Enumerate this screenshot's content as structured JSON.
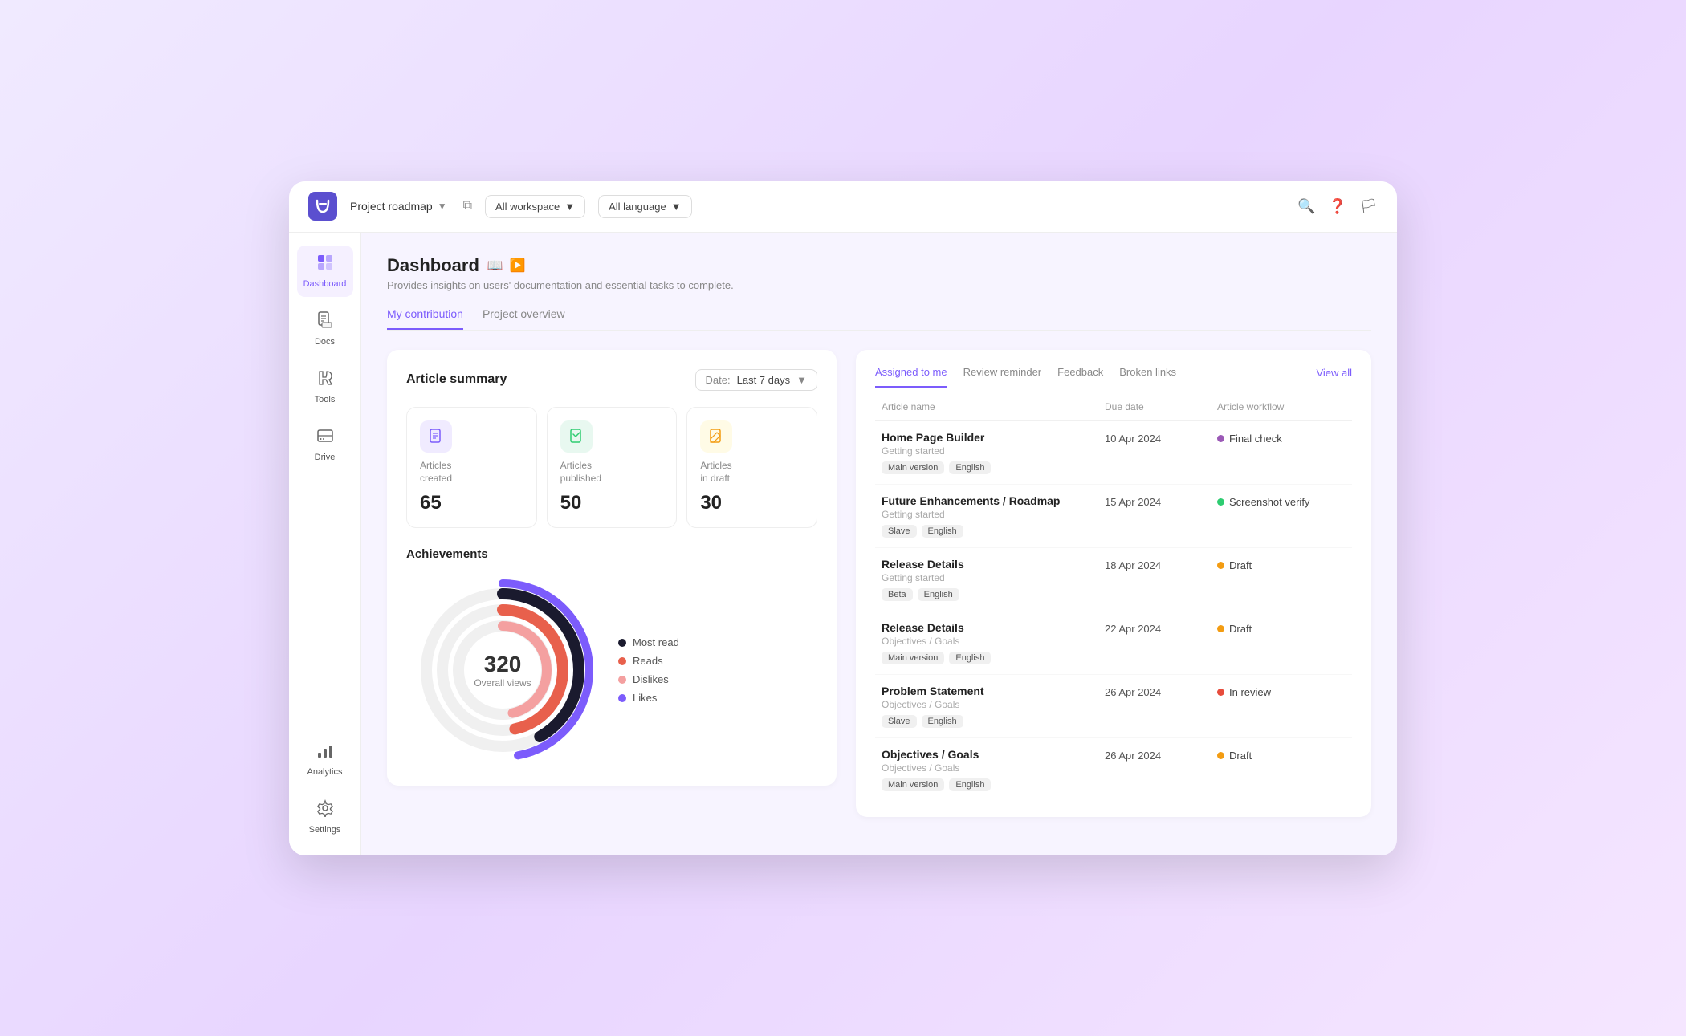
{
  "topbar": {
    "project_name": "Project roadmap",
    "workspace_filter": "All workspace",
    "language_filter": "All language"
  },
  "sidebar": {
    "items": [
      {
        "id": "dashboard",
        "label": "Dashboard",
        "icon": "🏠",
        "active": true
      },
      {
        "id": "docs",
        "label": "Docs",
        "icon": "📚",
        "active": false
      },
      {
        "id": "tools",
        "label": "Tools",
        "icon": "🔧",
        "active": false
      },
      {
        "id": "drive",
        "label": "Drive",
        "icon": "🗄️",
        "active": false
      },
      {
        "id": "analytics",
        "label": "Analytics",
        "icon": "📊",
        "active": false
      },
      {
        "id": "settings",
        "label": "Settings",
        "icon": "⚙️",
        "active": false
      }
    ]
  },
  "page": {
    "title": "Dashboard",
    "subtitle": "Provides insights on users' documentation and essential tasks to complete.",
    "tabs": [
      {
        "label": "My contribution",
        "active": true
      },
      {
        "label": "Project overview",
        "active": false
      }
    ]
  },
  "article_summary": {
    "card_title": "Article summary",
    "date_filter": {
      "prefix": "Date:",
      "value": "Last 7 days"
    },
    "stats": [
      {
        "id": "created",
        "label": "Articles\ncreated",
        "value": "65",
        "icon": "📄",
        "color": "purple"
      },
      {
        "id": "published",
        "label": "Articles\npublished",
        "value": "50",
        "icon": "📋",
        "color": "green"
      },
      {
        "id": "draft",
        "label": "Articles\nin draft",
        "value": "30",
        "icon": "📝",
        "color": "yellow"
      }
    ]
  },
  "achievements": {
    "title": "Achievements",
    "chart": {
      "center_value": "320",
      "center_label": "Overall views"
    },
    "legend": [
      {
        "label": "Most read",
        "color": "#1a1a2e"
      },
      {
        "label": "Reads",
        "color": "#e8604c"
      },
      {
        "label": "Dislikes",
        "color": "#f4a0a0"
      },
      {
        "label": "Likes",
        "color": "#7c5cfc"
      }
    ]
  },
  "right_panel": {
    "tabs": [
      {
        "label": "Assigned to me",
        "active": true
      },
      {
        "label": "Review reminder",
        "active": false
      },
      {
        "label": "Feedback",
        "active": false
      },
      {
        "label": "Broken links",
        "active": false
      }
    ],
    "view_all_label": "View all",
    "table": {
      "headers": [
        {
          "label": "Article name"
        },
        {
          "label": "Due date"
        },
        {
          "label": "Article workflow"
        }
      ],
      "rows": [
        {
          "name": "Home Page Builder",
          "category": "Getting started",
          "tags": [
            "Main version",
            "English"
          ],
          "due_date": "10 Apr 2024",
          "workflow": "Final check",
          "workflow_color": "#9b59b6"
        },
        {
          "name": "Future Enhancements / Roadmap",
          "category": "Getting started",
          "tags": [
            "Slave",
            "English"
          ],
          "due_date": "15 Apr 2024",
          "workflow": "Screenshot verify",
          "workflow_color": "#2ecc71"
        },
        {
          "name": "Release Details",
          "category": "Getting started",
          "tags": [
            "Beta",
            "English"
          ],
          "due_date": "18 Apr 2024",
          "workflow": "Draft",
          "workflow_color": "#f39c12"
        },
        {
          "name": "Release Details",
          "category": "Objectives / Goals",
          "tags": [
            "Main version",
            "English"
          ],
          "due_date": "22 Apr 2024",
          "workflow": "Draft",
          "workflow_color": "#f39c12"
        },
        {
          "name": "Problem Statement",
          "category": "Objectives / Goals",
          "tags": [
            "Slave",
            "English"
          ],
          "due_date": "26 Apr 2024",
          "workflow": "In review",
          "workflow_color": "#e74c3c"
        },
        {
          "name": "Objectives / Goals",
          "category": "Objectives / Goals",
          "tags": [
            "Main version",
            "English"
          ],
          "due_date": "26 Apr 2024",
          "workflow": "Draft",
          "workflow_color": "#f39c12"
        }
      ]
    }
  }
}
